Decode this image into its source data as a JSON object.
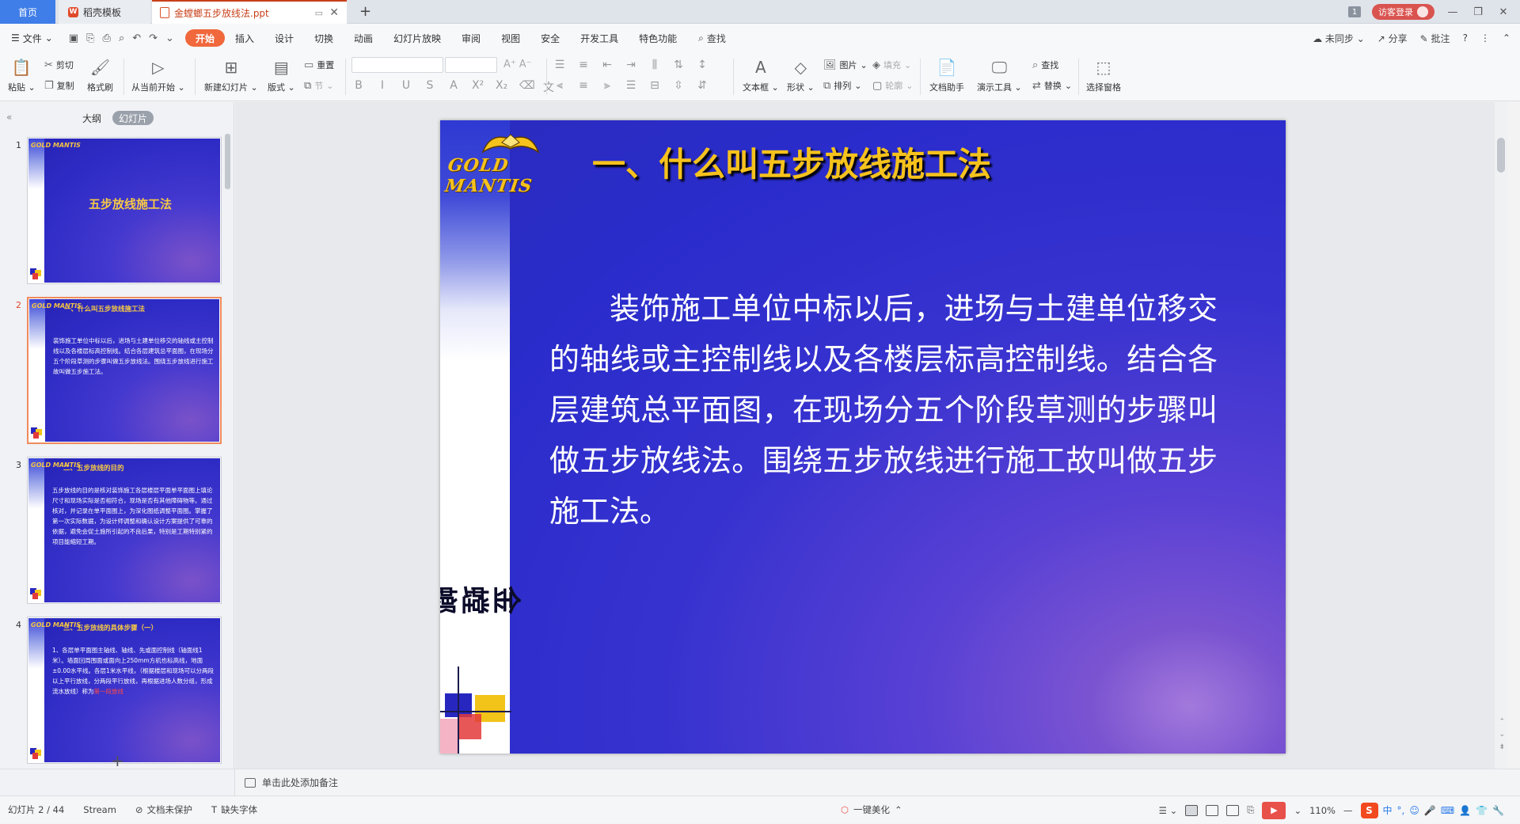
{
  "tabs": [
    {
      "label": "首页"
    },
    {
      "label": "稻壳模板"
    },
    {
      "label": "金螳螂五步放线法.ppt"
    }
  ],
  "titlebar": {
    "notif_count": "1",
    "login_label": "访客登录"
  },
  "menu": {
    "file_label": "文件",
    "items": [
      "开始",
      "插入",
      "设计",
      "切换",
      "动画",
      "幻灯片放映",
      "审阅",
      "视图",
      "安全",
      "开发工具",
      "特色功能"
    ],
    "search_label": "查找",
    "right": {
      "sync": "未同步",
      "share": "分享",
      "comment": "批注"
    }
  },
  "ribbon": {
    "paste": "粘贴",
    "cut": "剪切",
    "copy": "复制",
    "format_painter": "格式刷",
    "play_from_current": "从当前开始",
    "new_slide": "新建幻灯片",
    "layout": "版式",
    "reset": "重置",
    "section": "节",
    "textbox": "文本框",
    "shape": "形状",
    "picture": "图片",
    "fill": "填充",
    "arrange": "排列",
    "outline": "轮廓",
    "doc_helper": "文档助手",
    "present_tools": "演示工具",
    "find": "查找",
    "replace": "替换",
    "select_pane": "选择窗格"
  },
  "left_panel": {
    "tabs": [
      "大纲",
      "幻灯片"
    ],
    "active_tab": "幻灯片"
  },
  "thumbnails": [
    {
      "num": "1",
      "title": "五步放线施工法",
      "text": ""
    },
    {
      "num": "2",
      "title": "一、什么叫五步放线施工法",
      "text": "装饰施工单位中标以后，进场与土建单位移交的轴线或主控制线以及各楼层标高控制线。结合各层建筑总平面图，在现场分五个阶段草测的步骤叫做五步放线法。围绕五步放线进行施工故叫做五步施工法。"
    },
    {
      "num": "3",
      "title": "二、五步放线的目的",
      "text": "五步放线的目的是核对装饰施工各层楼层平面单平面图上填论尺寸和现场实际是否相符合，现场是否有其他障碍物等。通过核对，并记录在单平面图上，为深化图纸调整平面图。掌握了第一次实际数据，为设计师调整和确认设计方案提供了可靠的依据，避免会促土施所引起的不良后果，特别是工期特别紧的项目能缩短工期。"
    },
    {
      "num": "4",
      "title": "三、五步放线的具体步骤（一）",
      "text": "1、各层单平面图主轴线、轴线、先或面控制线（轴面线1米）。墙面回周围面或面向上250mm方机也标高线，地面±0.00水平线。各层1米水平线，（根据楼层和现场可以分两段以上平行放线，分两段平行放线，再根据进场人数分组，形成流水放线）称为",
      "highlight": "第一段放线"
    }
  ],
  "slide": {
    "logo_text": "GOLD MANTIS",
    "title": "一、什么叫五步放线施工法",
    "body": "装饰施工单位中标以后，进场与土建单位移交的轴线或主控制线以及各楼层标高控制线。结合各层建筑总平面图，在现场分五个阶段草测的步骤叫做五步放线法。围绕五步放线进行施工故叫做五步施工法。",
    "vertical_brand": "金螳螂",
    "colors": {
      "title": "#f6c21c",
      "body": "#ffffff",
      "background": "#2a2ccb"
    }
  },
  "notes": {
    "placeholder": "单击此处添加备注"
  },
  "status": {
    "slide_counter": "幻灯片 2 / 44",
    "theme": "Stream",
    "protect": "文档未保护",
    "missing_font": "缺失字体",
    "beautify": "一键美化",
    "zoom": "110%",
    "ime_label": "中"
  }
}
